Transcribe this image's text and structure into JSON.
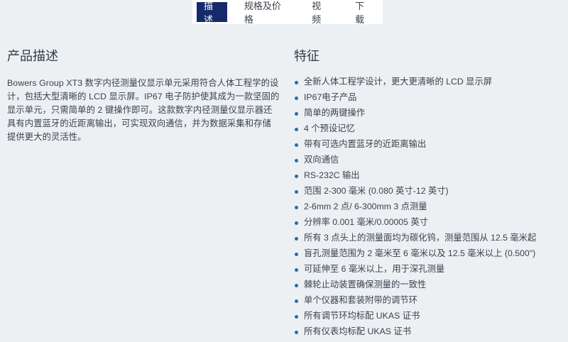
{
  "tabs": [
    {
      "label": "描述",
      "active": true
    },
    {
      "label": "规格及价格",
      "active": false
    },
    {
      "label": "视频",
      "active": false
    },
    {
      "label": "下载",
      "active": false
    }
  ],
  "description": {
    "title": "产品描述",
    "text": "Bowers Group XT3 数字内径测量仪显示单元采用符合人体工程学的设计，包括大型清晰的 LCD 显示屏。IP67 电子防护使其成为一款坚固的显示单元，只需简单的 2 键操作即可。这款数字内径测量仪显示器还具有内置蓝牙的近距离输出，可实现双向通信，并为数据采集和存储提供更大的灵活性。"
  },
  "features": {
    "title": "特征",
    "items": [
      "全新人体工程学设计，更大更清晰的 LCD 显示屏",
      "IP67电子产品",
      "简单的两键操作",
      "4 个预设记忆",
      "带有可选内置蓝牙的近距离输出",
      "双向通信",
      "RS-232C 输出",
      "范围 2-300 毫米 (0.080 英寸-12 英寸)",
      "2-6mm 2 点/ 6-300mm 3 点测量",
      "分辨率 0.001 毫米/0.00005 英寸",
      "所有 3 点头上的测量面均为碳化钨，测量范围从 12.5 毫米起",
      "盲孔测量范围为 2 毫米至 6 毫米以及 12.5 毫米以上 (0.500\")",
      "可延伸至 6 毫米以上，用于深孔测量",
      "棘轮止动装置确保测量的一致性",
      "单个仪器和套装附带的调节环",
      "所有调节环均标配 UKAS 证书",
      "所有仪表均标配 UKAS 证书"
    ]
  },
  "colors": {
    "active_tab": "#16296b",
    "bullet": "#2b6aa6",
    "background": "#ecf0f3"
  }
}
